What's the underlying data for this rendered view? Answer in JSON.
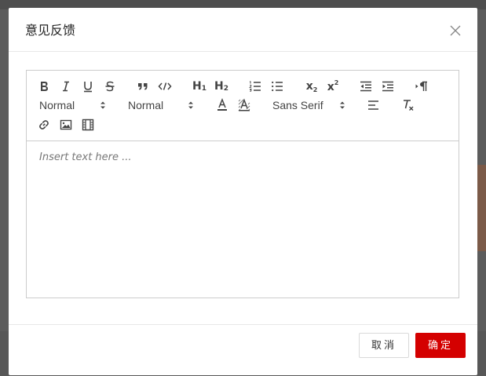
{
  "dialog": {
    "title": "意见反馈",
    "close_icon": "close-icon"
  },
  "toolbar": {
    "header_picker": "Normal",
    "size_picker": "Normal",
    "font_picker": "Sans Serif",
    "h1_label": "H",
    "h1_sub": "1",
    "h2_label": "H",
    "h2_sub": "2",
    "sub_label": "x",
    "sub_sub": "2",
    "sup_label": "x",
    "sup_sup": "2",
    "icons": [
      "bold-icon",
      "italic-icon",
      "underline-icon",
      "strike-icon",
      "blockquote-icon",
      "code-block-icon",
      "h1-icon",
      "h2-icon",
      "ordered-list-icon",
      "bullet-list-icon",
      "subscript-icon",
      "superscript-icon",
      "outdent-icon",
      "indent-icon",
      "rtl-icon",
      "font-color-icon",
      "background-color-icon",
      "align-icon",
      "clean-icon",
      "link-icon",
      "image-icon",
      "video-icon"
    ]
  },
  "editor": {
    "placeholder": "Insert text here ..."
  },
  "footer": {
    "cancel_label": "取消",
    "ok_label": "确定"
  },
  "colors": {
    "primary": "#d40000",
    "backdrop": "#5c5c5c"
  }
}
